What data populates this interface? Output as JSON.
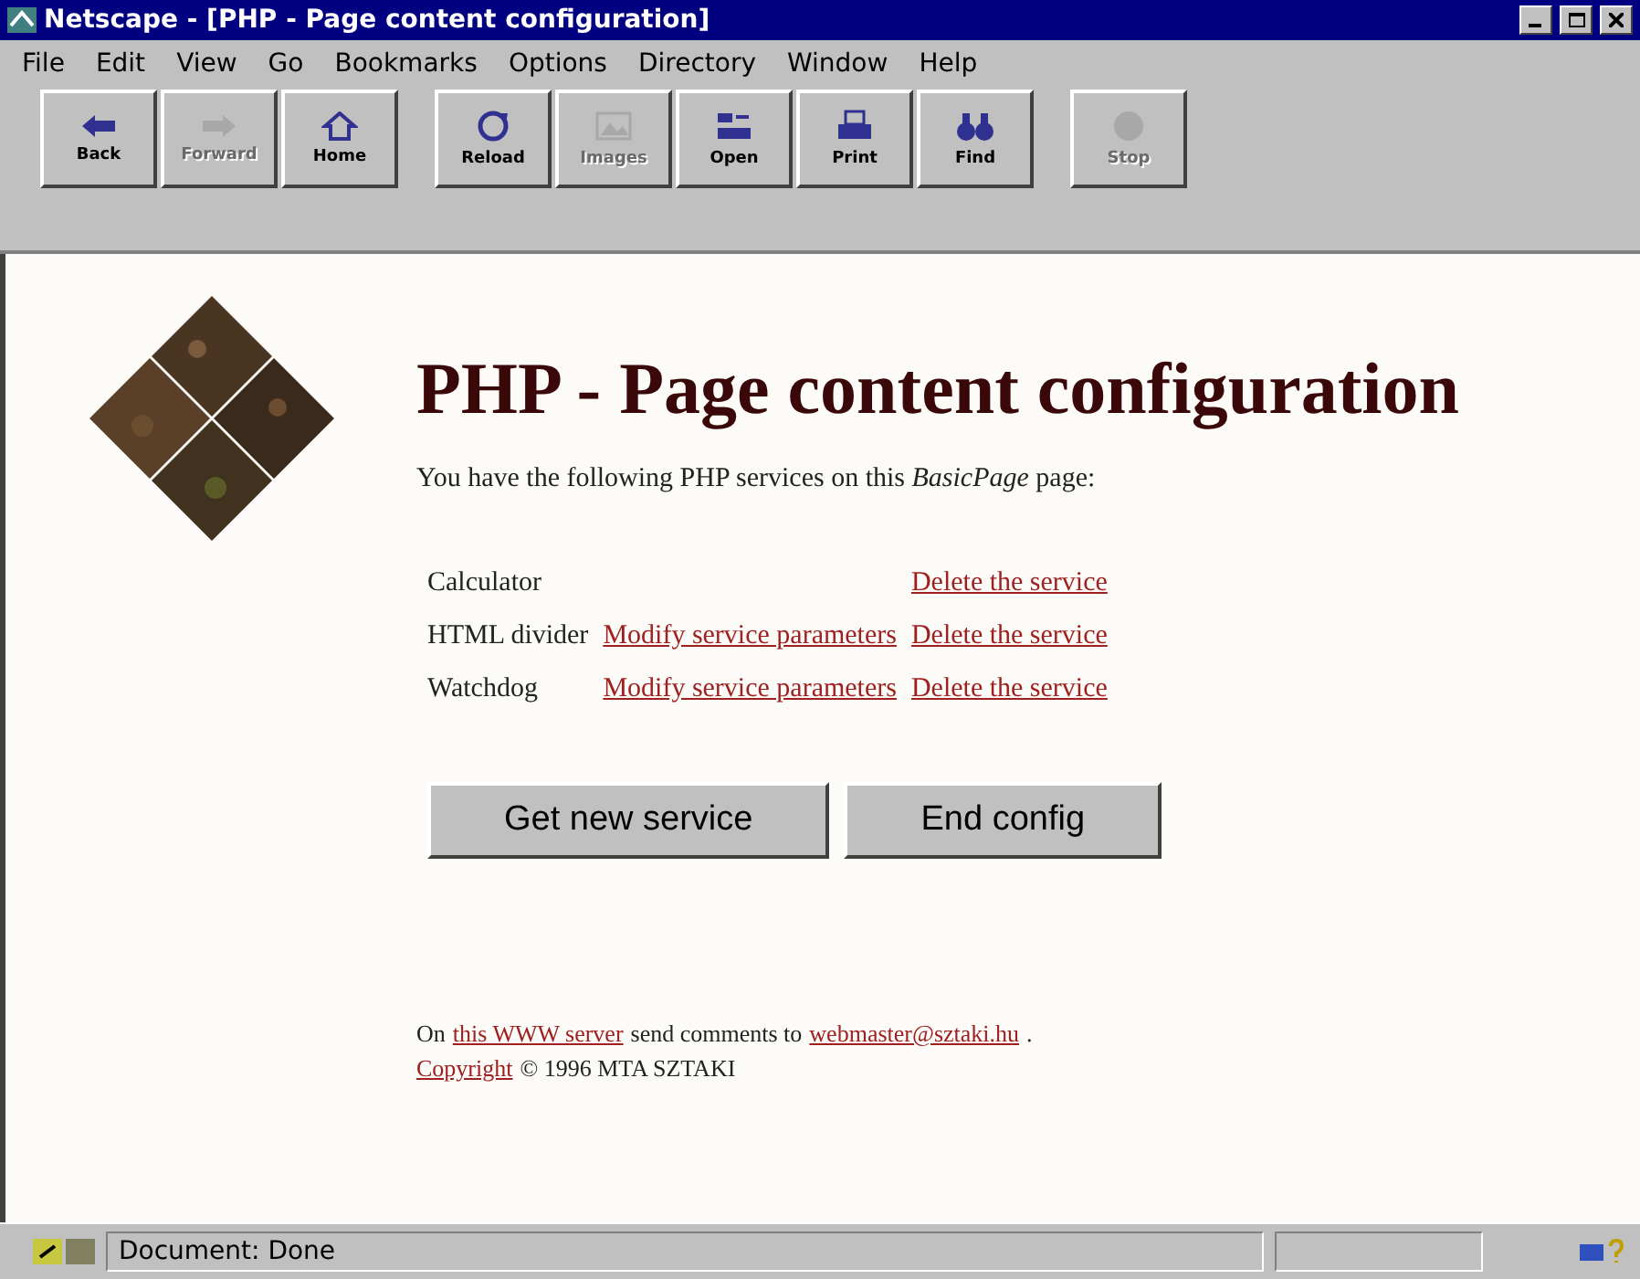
{
  "window": {
    "title": "Netscape - [PHP - Page content configuration]"
  },
  "menu": [
    "File",
    "Edit",
    "View",
    "Go",
    "Bookmarks",
    "Options",
    "Directory",
    "Window",
    "Help"
  ],
  "toolbar": [
    [
      {
        "label": "Back",
        "disabled": false
      },
      {
        "label": "Forward",
        "disabled": true
      },
      {
        "label": "Home",
        "disabled": false
      }
    ],
    [
      {
        "label": "Reload",
        "disabled": false
      },
      {
        "label": "Images",
        "disabled": true
      },
      {
        "label": "Open",
        "disabled": false
      },
      {
        "label": "Print",
        "disabled": false
      },
      {
        "label": "Find",
        "disabled": false
      }
    ],
    [
      {
        "label": "Stop",
        "disabled": true
      }
    ]
  ],
  "page": {
    "heading": "PHP - Page content configuration",
    "intro": "You have the following PHP services on this *BasicPage* page:",
    "services": [
      {
        "name": "Calculator",
        "delete": "Delete the service"
      },
      {
        "name": "HTML divider",
        "modify": "Modify service parameters",
        "delete": "Delete the service"
      },
      {
        "name": "Watchdog",
        "modify": "Modify service parameters",
        "delete": "Delete the service"
      }
    ],
    "buttons": [
      "Get new service",
      "End config"
    ],
    "footer": {
      "line1": [
        {
          "kind": "text",
          "text": "On"
        },
        {
          "kind": "link",
          "text": "this WWW server"
        },
        {
          "kind": "text",
          "text": "send comments to"
        },
        {
          "kind": "link",
          "text": "webmaster@sztaki.hu"
        },
        {
          "kind": "text",
          "text": "."
        }
      ],
      "line2": [
        {
          "kind": "link",
          "text": "Copyright"
        },
        {
          "kind": "text",
          "text": "© 1996 MTA SZTAKI"
        }
      ]
    }
  },
  "status_bar": {
    "text": "Document: Done"
  }
}
